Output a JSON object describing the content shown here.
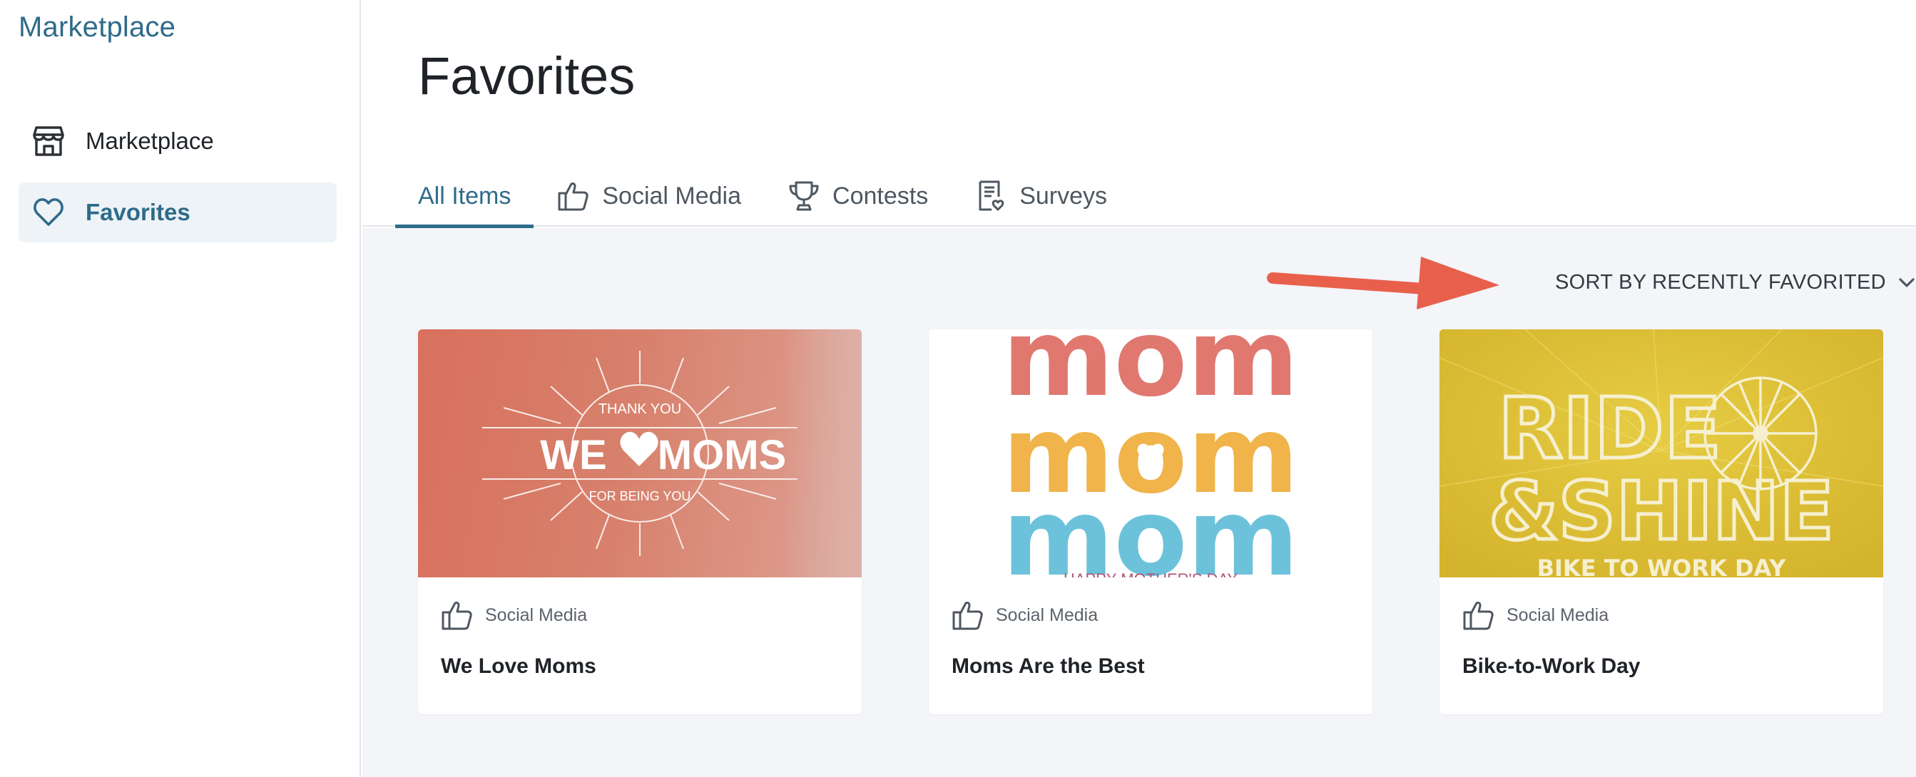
{
  "sidebar": {
    "brand": "Marketplace",
    "items": [
      {
        "label": "Marketplace",
        "icon": "storefront-icon",
        "active": false
      },
      {
        "label": "Favorites",
        "icon": "heart-icon",
        "active": true
      }
    ]
  },
  "header": {
    "title": "Favorites",
    "tabs": [
      {
        "label": "All Items",
        "icon": "",
        "active": true
      },
      {
        "label": "Social Media",
        "icon": "thumbs-up-icon",
        "active": false
      },
      {
        "label": "Contests",
        "icon": "trophy-icon",
        "active": false
      },
      {
        "label": "Surveys",
        "icon": "survey-icon",
        "active": false
      }
    ]
  },
  "toolbar": {
    "sort_label": "SORT BY RECENTLY FAVORITED"
  },
  "cards": [
    {
      "category": "Social Media",
      "title": "We Love Moms",
      "thumb": {
        "top_text": "THANK YOU",
        "left_word": "WE",
        "right_word": "MOMS",
        "bottom_text": "FOR BEING YOU"
      }
    },
    {
      "category": "Social Media",
      "title": "Moms Are the Best",
      "thumb": {
        "line1": "mom",
        "line2": "mom",
        "line3": "mom",
        "footer": "HAPPY MOTHER'S DAY"
      }
    },
    {
      "category": "Social Media",
      "title": "Bike-to-Work Day",
      "thumb": {
        "line1": "RIDE",
        "line2": "&SHINE",
        "line3": "BIKE TO WORK DAY"
      }
    }
  ],
  "colors": {
    "accent": "#2f6b8a",
    "active_nav_bg": "#edf3f6",
    "content_bg": "#f3f5f8",
    "annotation_arrow": "#e8604c"
  }
}
